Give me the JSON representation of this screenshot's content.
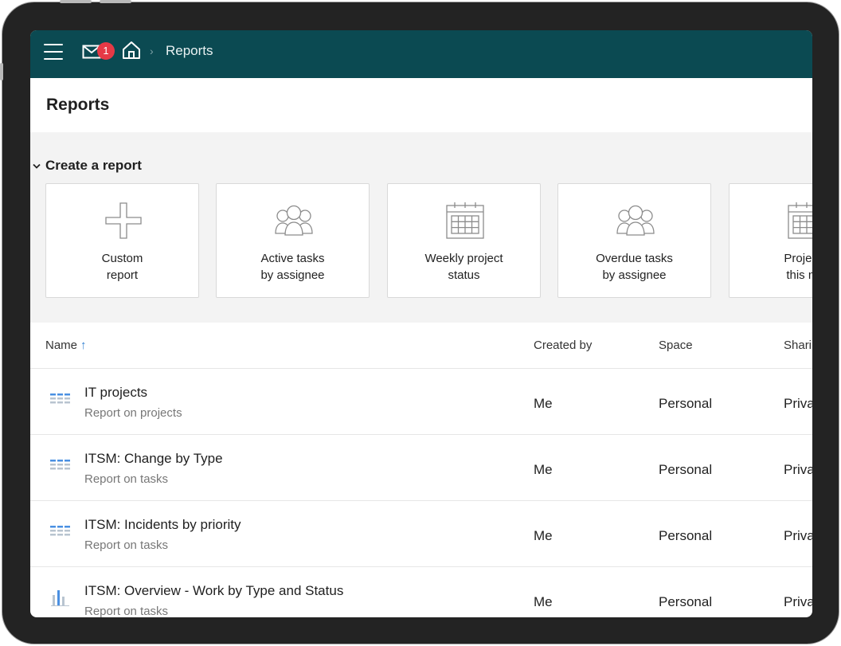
{
  "topbar": {
    "notification_count": "1",
    "breadcrumb": "Reports",
    "breadcrumb_separator": "›"
  },
  "page": {
    "title": "Reports"
  },
  "create": {
    "heading": "Create a report",
    "cards": [
      {
        "line1": "Custom",
        "line2": "report",
        "icon": "plus-icon"
      },
      {
        "line1": "Active tasks",
        "line2": "by assignee",
        "icon": "people-icon"
      },
      {
        "line1": "Weekly project",
        "line2": "status",
        "icon": "calendar-icon"
      },
      {
        "line1": "Overdue tasks",
        "line2": "by assignee",
        "icon": "people-icon"
      },
      {
        "line1": "Projects",
        "line2": "this mo",
        "icon": "calendar-icon"
      }
    ]
  },
  "table": {
    "headers": {
      "name": "Name",
      "sort_arrow": "↑",
      "created_by": "Created by",
      "space": "Space",
      "sharing": "Sharing"
    },
    "rows": [
      {
        "name": "IT projects",
        "sub": "Report on projects",
        "created_by": "Me",
        "space": "Personal",
        "sharing": "Private",
        "icon": "table-report-icon"
      },
      {
        "name": "ITSM: Change by Type",
        "sub": "Report on tasks",
        "created_by": "Me",
        "space": "Personal",
        "sharing": "Private",
        "icon": "table-report-icon"
      },
      {
        "name": "ITSM: Incidents by priority",
        "sub": "Report on tasks",
        "created_by": "Me",
        "space": "Personal",
        "sharing": "Private",
        "icon": "table-report-icon"
      },
      {
        "name": "ITSM: Overview - Work by Type and Status",
        "sub": "Report on tasks",
        "created_by": "Me",
        "space": "Personal",
        "sharing": "Private",
        "icon": "bar-chart-report-icon"
      }
    ]
  },
  "colors": {
    "topbar": "#0b4a52",
    "badge": "#e63946",
    "accent": "#2f7fd1"
  }
}
